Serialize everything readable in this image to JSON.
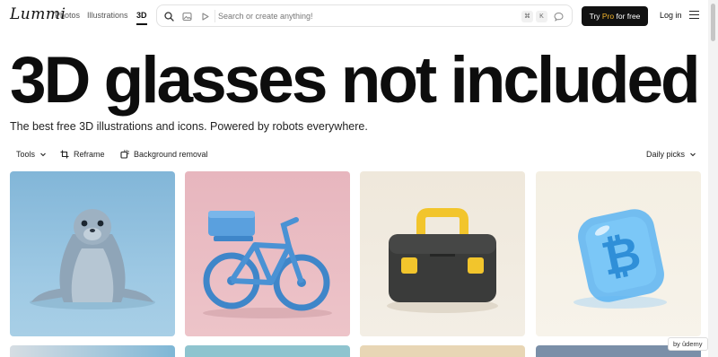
{
  "header": {
    "logo": "Lummi",
    "nav": [
      "Photos",
      "Illustrations",
      "3D"
    ],
    "search": {
      "placeholder": "Search or create anything!",
      "shortcut_keys": [
        "⌘",
        "K"
      ],
      "icons": [
        "search-icon",
        "image-icon",
        "play-icon",
        "chat-icon"
      ]
    },
    "pro_button": {
      "prefix": "Try ",
      "highlight": "Pro",
      "suffix": " for free",
      "highlight_color": "#f5b52a"
    },
    "login": "Log in"
  },
  "hero": {
    "title": "3D glasses not included",
    "subtitle": "The best free 3D illustrations and icons. Powered by robots everywhere."
  },
  "toolbar": {
    "tools": "Tools",
    "reframe": "Reframe",
    "background_removal": "Background removal",
    "sort": "Daily picks"
  },
  "gallery": {
    "items": [
      "3D seal",
      "3D bicycle with box",
      "3D toolbox",
      "3D glass bitcoin"
    ]
  },
  "badge": {
    "by": "by",
    "brand": "ûdemy"
  }
}
